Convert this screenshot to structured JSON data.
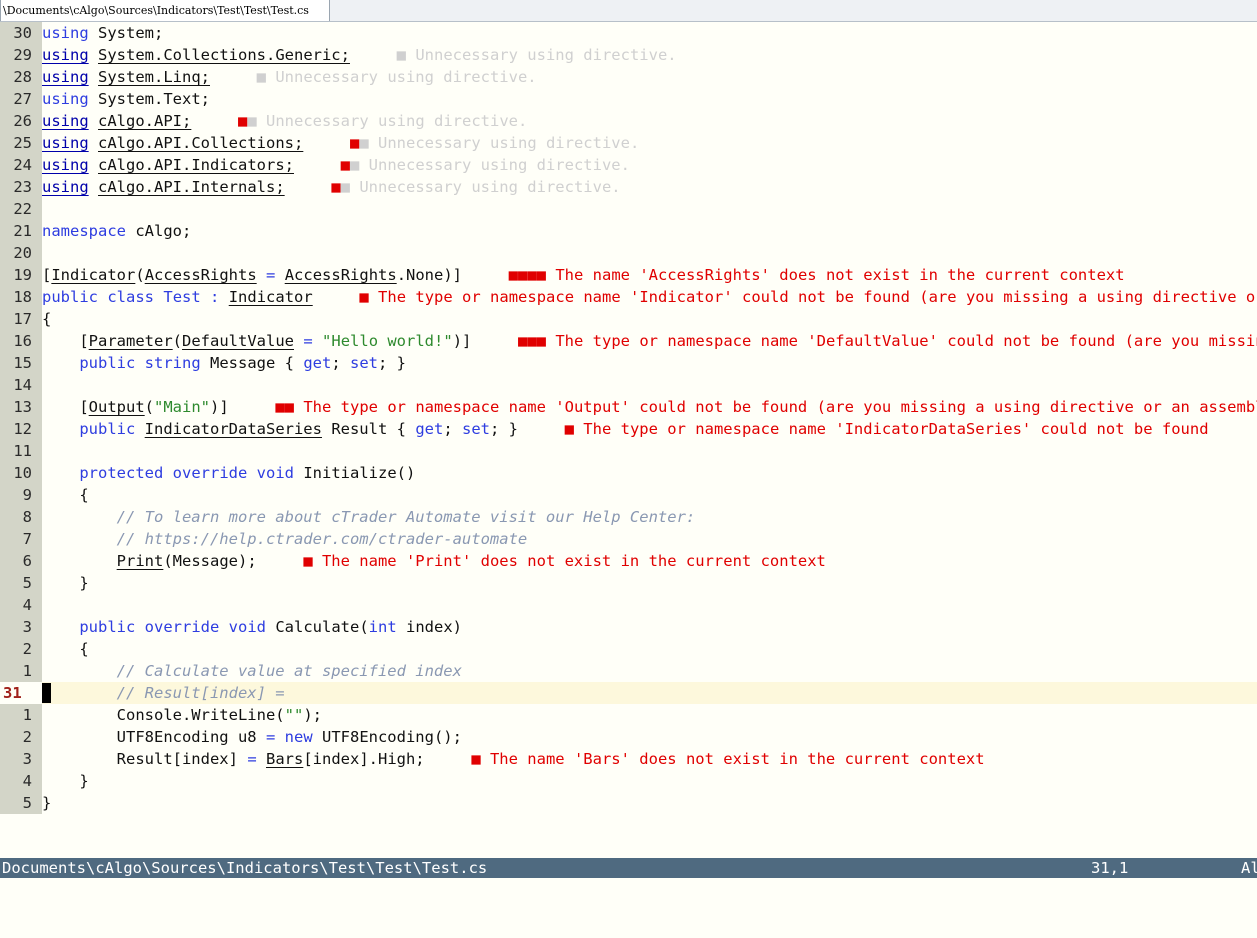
{
  "tab": {
    "label": "\\Documents\\cAlgo\\Sources\\Indicators\\Test\\Test\\Test.cs"
  },
  "lines": [
    {
      "ln": "30",
      "code": "<span class='kw'>using</span> System;"
    },
    {
      "ln": "29",
      "code": "<span class='uk'>using</span> <span class='u'>System.Collections.Generic;</span>     <span class='warn'>■ Unnecessary using directive.</span>"
    },
    {
      "ln": "28",
      "code": "<span class='uk'>using</span> <span class='u'>System.Linq;</span>     <span class='warn'>■ Unnecessary using directive.</span>"
    },
    {
      "ln": "27",
      "code": "<span class='kw'>using</span> System.Text;"
    },
    {
      "ln": "26",
      "code": "<span class='uk'>using</span> <span class='u'>cAlgo.API;</span>     <span class='err'>■</span><span class='warn'>■ Unnecessary using directive.</span>"
    },
    {
      "ln": "25",
      "code": "<span class='uk'>using</span> <span class='u'>cAlgo.API.Collections;</span>     <span class='err'>■</span><span class='warn'>■ Unnecessary using directive.</span>"
    },
    {
      "ln": "24",
      "code": "<span class='uk'>using</span> <span class='u'>cAlgo.API.Indicators;</span>     <span class='err'>■</span><span class='warn'>■ Unnecessary using directive.</span>"
    },
    {
      "ln": "23",
      "code": "<span class='uk'>using</span> <span class='u'>cAlgo.API.Internals;</span>     <span class='err'>■</span><span class='warn'>■ Unnecessary using directive.</span>"
    },
    {
      "ln": "22",
      "code": ""
    },
    {
      "ln": "21",
      "code": "<span class='kw'>namespace</span> cAlgo;"
    },
    {
      "ln": "20",
      "code": ""
    },
    {
      "ln": "19",
      "code": "[<span class='u'>Indicator</span>(<span class='u'>AccessRights</span> <span class='kw'>=</span> <span class='u'>AccessRights</span>.None)]     <span class='err'>■■■■ The name 'AccessRights' does not exist in the current context</span>"
    },
    {
      "ln": "18",
      "code": "<span class='kw'>public</span> <span class='kw'>class</span> <span class='ty'>Test</span> <span class='kw'>:</span> <span class='u'>Indicator</span>     <span class='err'>■ The type or namespace name 'Indicator' could not be found (are you missing a using directive or an assembly reference?)</span>"
    },
    {
      "ln": "17",
      "code": "{"
    },
    {
      "ln": "16",
      "code": "    [<span class='u'>Parameter</span>(<span class='u'>DefaultValue</span> <span class='kw'>=</span> <span class='str'>\"Hello world!\"</span>)]     <span class='err'>■■■ The type or namespace name 'DefaultValue' could not be found (are you missing a using directive?)</span>"
    },
    {
      "ln": "15",
      "code": "    <span class='kw'>public</span> <span class='kw'>string</span> Message { <span class='kw'>get</span>; <span class='kw'>set</span>; }"
    },
    {
      "ln": "14",
      "code": ""
    },
    {
      "ln": "13",
      "code": "    [<span class='u'>Output</span>(<span class='str'>\"Main\"</span>)]     <span class='err'>■■ The type or namespace name 'Output' could not be found (are you missing a using directive or an assembly reference?)</span>"
    },
    {
      "ln": "12",
      "code": "    <span class='kw'>public</span> <span class='u'>IndicatorDataSeries</span> Result { <span class='kw'>get</span>; <span class='kw'>set</span>; }     <span class='err'>■ The type or namespace name 'IndicatorDataSeries' could not be found</span>"
    },
    {
      "ln": "11",
      "code": ""
    },
    {
      "ln": "10",
      "code": "    <span class='kw'>protected</span> <span class='kw'>override</span> <span class='kw'>void</span> Initialize()"
    },
    {
      "ln": "9",
      "code": "    {"
    },
    {
      "ln": "8",
      "code": "        <span class='cm'>// To learn more about cTrader Automate visit our Help Center:</span>"
    },
    {
      "ln": "7",
      "code": "        <span class='cm'>// https://help.ctrader.com/ctrader-automate</span>"
    },
    {
      "ln": "6",
      "code": "        <span class='u'>Print</span>(Message);     <span class='err'>■ The name 'Print' does not exist in the current context</span>"
    },
    {
      "ln": "5",
      "code": "    }"
    },
    {
      "ln": "4",
      "code": ""
    },
    {
      "ln": "3",
      "code": "    <span class='kw'>public</span> <span class='kw'>override</span> <span class='kw'>void</span> Calculate(<span class='kw'>int</span> index)"
    },
    {
      "ln": "2",
      "code": "    {"
    },
    {
      "ln": "1",
      "code": "        <span class='cm'>// Calculate value at specified index</span>"
    },
    {
      "ln": "31",
      "code": "        <span class='cm'>// Result[index] =</span>",
      "current": true
    },
    {
      "ln": "1",
      "code": "        Console.WriteLine(<span class='str'>\"\"</span>);"
    },
    {
      "ln": "2",
      "code": "        UTF8Encoding u8 <span class='kw'>=</span> <span class='kw'>new</span> UTF8Encoding();"
    },
    {
      "ln": "3",
      "code": "        Result[index] <span class='kw'>=</span> <span class='u'>Bars</span>[index].High;     <span class='err'>■ The name 'Bars' does not exist in the current context</span>"
    },
    {
      "ln": "4",
      "code": "    }"
    },
    {
      "ln": "5",
      "code": "}"
    }
  ],
  "status": {
    "path": "Documents\\cAlgo\\Sources\\Indicators\\Test\\Test\\Test.cs",
    "position": "31,1",
    "scroll": "All"
  }
}
